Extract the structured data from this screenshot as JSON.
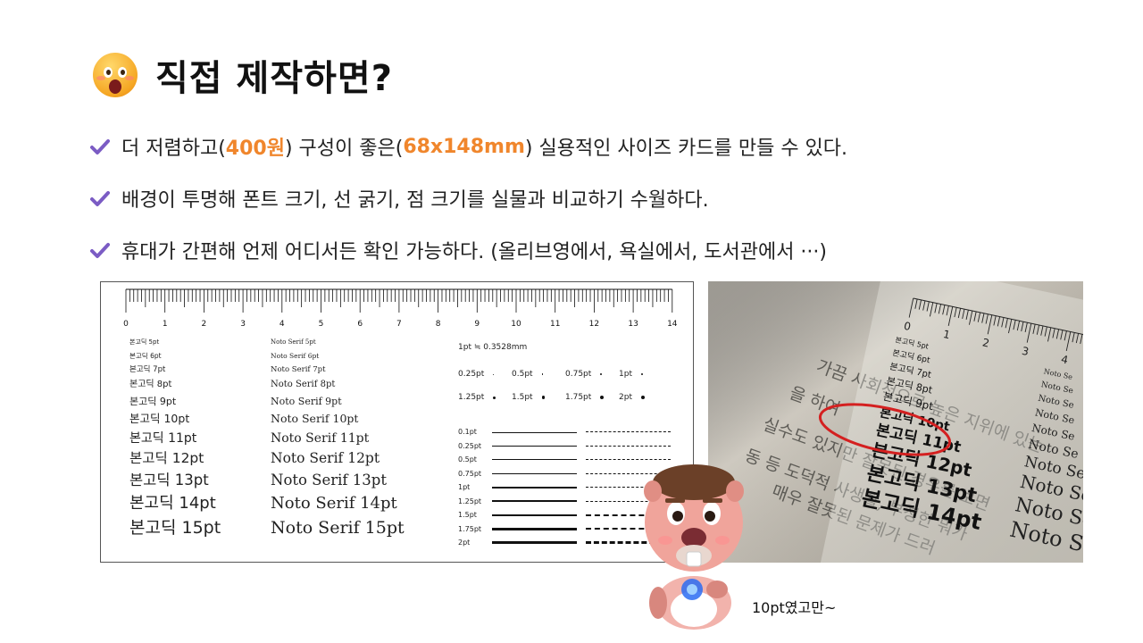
{
  "title": "직접 제작하면?",
  "bullets": [
    {
      "pre": "더 저렴하고(",
      "hl1": "400원",
      "mid": ") 구성이 좋은(",
      "hl2": "68x148mm",
      "post": ") 실용적인 사이즈 카드를 만들 수 있다."
    },
    {
      "text": "배경이 투명해 폰트 크기, 선 굵기, 점 크기를 실물과 비교하기 수월하다."
    },
    {
      "text": "휴대가 간편해 언제 어디서든 확인 가능하다. (올리브영에서, 욕실에서, 도서관에서 ···)"
    }
  ],
  "card": {
    "ruler_numbers": [
      "0",
      "1",
      "2",
      "3",
      "4",
      "5",
      "6",
      "7",
      "8",
      "9",
      "10",
      "11",
      "12",
      "13",
      "14"
    ],
    "sans_samples": [
      "본고딕 5pt",
      "본고딕 6pt",
      "본고딕 7pt",
      "본고딕 8pt",
      "본고딕 9pt",
      "본고딕 10pt",
      "본고딕 11pt",
      "본고딕 12pt",
      "본고딕 13pt",
      "본고딕 14pt",
      "본고딕 15pt"
    ],
    "serif_samples": [
      "Noto Serif 5pt",
      "Noto Serif 6pt",
      "Noto Serif 7pt",
      "Noto Serif 8pt",
      "Noto Serif 9pt",
      "Noto Serif 10pt",
      "Noto Serif 11pt",
      "Noto Serif 12pt",
      "Noto Serif 13pt",
      "Noto Serif 14pt",
      "Noto Serif 15pt"
    ],
    "conversion": "1pt ≒ 0.3528mm",
    "dot_row1": [
      "0.25pt",
      "0.5pt",
      "0.75pt",
      "1pt"
    ],
    "dot_row2": [
      "1.25pt",
      "1.5pt",
      "1.75pt",
      "2pt"
    ],
    "line_labels": [
      "0.1pt",
      "0.25pt",
      "0.5pt",
      "0.75pt",
      "1pt",
      "1.25pt",
      "1.5pt",
      "1.75pt",
      "2pt"
    ]
  },
  "photo": {
    "ruler_numbers": [
      "0",
      "1",
      "2",
      "3",
      "4"
    ],
    "sans_labels": [
      "본고딕 5pt",
      "본고딕 6pt",
      "본고딕 7pt",
      "본고딕 8pt",
      "본고딕 9pt",
      "본고딕 10pt",
      "본고딕 11pt",
      "본고딕 12pt",
      "본고딕 13pt",
      "본고딕 14pt"
    ],
    "serif_label": "Noto Se",
    "bg_lines": [
      "가끔 사회적으로 높은 지위에 있는",
      "을 하여",
      "실수도 있지만 잘못된 경우를 보면",
      "동 등 도덕적 사생활, 부정한 뭐가",
      "매우 잘못된 문제가 드러"
    ],
    "highlight_color": "#d42020"
  },
  "caption": "10pt였고만~",
  "colors": {
    "accent": "#f0862c",
    "check": "#7b5cc4"
  }
}
